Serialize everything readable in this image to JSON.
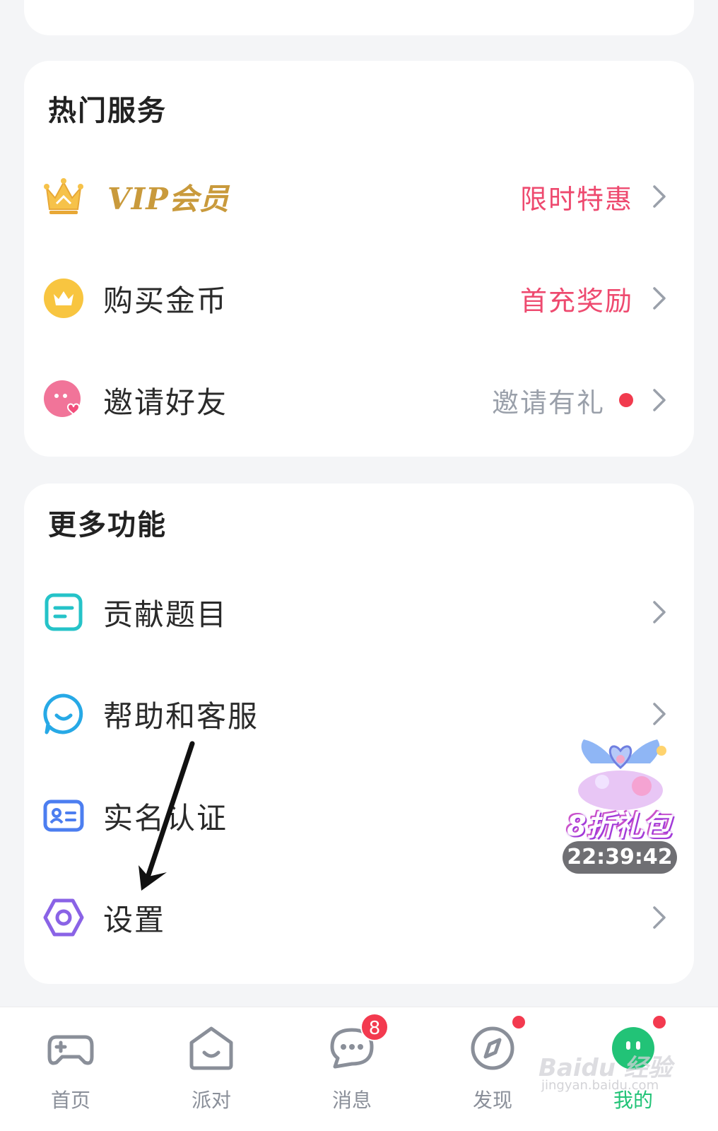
{
  "hot_services": {
    "title": "热门服务",
    "items": [
      {
        "label": "VIP会员",
        "right_text": "限时特惠",
        "icon": "crown-icon"
      },
      {
        "label": "购买金币",
        "right_text": "首充奖励",
        "icon": "gold-coin-icon"
      },
      {
        "label": "邀请好友",
        "right_text": "邀请有礼",
        "icon": "invite-friend-icon",
        "has_dot": true
      }
    ]
  },
  "more_features": {
    "title": "更多功能",
    "items": [
      {
        "label": "贡献题目",
        "icon": "document-icon"
      },
      {
        "label": "帮助和客服",
        "icon": "customer-service-icon"
      },
      {
        "label": "实名认证",
        "icon": "id-card-icon"
      },
      {
        "label": "设置",
        "icon": "settings-hexagon-icon"
      }
    ]
  },
  "promo": {
    "title": "8折礼包",
    "timer": "22:39:42"
  },
  "tabbar": {
    "tabs": [
      {
        "label": "首页",
        "icon": "gamepad-icon"
      },
      {
        "label": "派对",
        "icon": "house-smile-icon"
      },
      {
        "label": "消息",
        "icon": "chat-bubble-icon",
        "badge": "8"
      },
      {
        "label": "发现",
        "icon": "compass-icon",
        "dot": true
      },
      {
        "label": "我的",
        "icon": "avatar-face-icon",
        "dot": true,
        "active": true
      }
    ]
  },
  "watermark": {
    "text": "Baidu 经验",
    "sub": "jingyan.baidu.com"
  },
  "colors": {
    "accent_green": "#22c377",
    "highlight_red": "#ee4a6f",
    "vip_gold": "#c99a3c"
  }
}
